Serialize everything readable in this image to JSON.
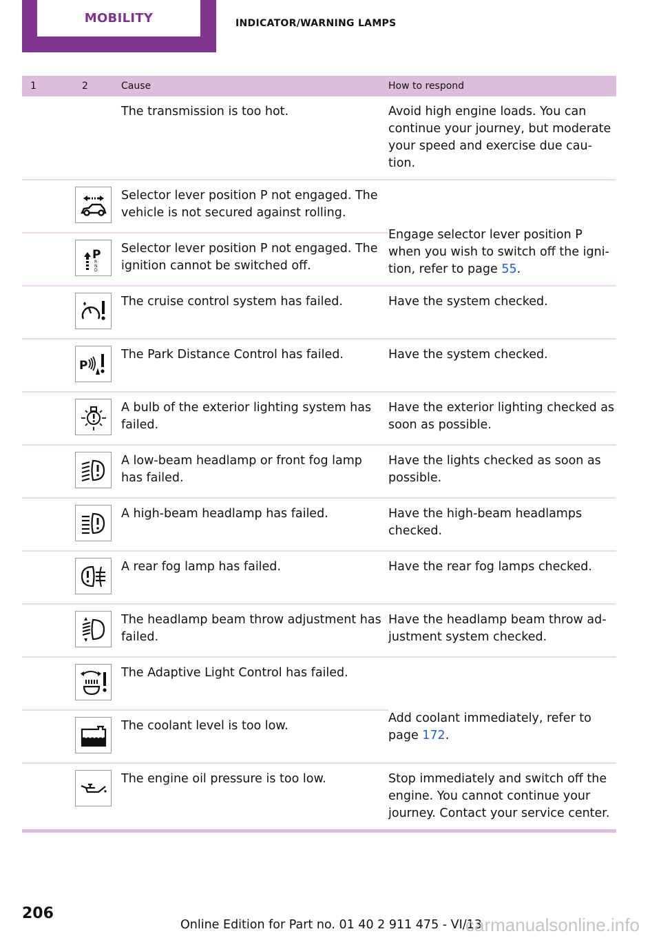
{
  "header": {
    "chapter": "MOBILITY",
    "section": "INDICATOR/WARNING LAMPS"
  },
  "colors": {
    "brand": "#7f348e",
    "header_row": "#dcbddb",
    "link": "#1a5fd6"
  },
  "table": {
    "columns": [
      "1",
      "2",
      "Cause",
      "How to respond"
    ],
    "rows": [
      {
        "icon": "none",
        "cause": "The transmission is too hot.",
        "respond": "Avoid high engine loads. You can continue your journey, but moderate your speed and exercise due cau-tion."
      },
      {
        "icon": "car-rolling-icon",
        "cause": "Selector lever position P not engaged. The vehicle is not secured against rolling.",
        "respond": ""
      },
      {
        "icon": "selector-lever-p-icon",
        "cause": "Selector lever position P not engaged. The ignition cannot be switched off.",
        "respond_prefix": "Engage selector lever position P when you wish to switch off the igni-tion, refer to page ",
        "respond_link": "55",
        "respond_suffix": "."
      },
      {
        "icon": "cruise-control-warning-icon",
        "cause": "The cruise control system has failed.",
        "respond": "Have the system checked."
      },
      {
        "icon": "park-distance-control-warning-icon",
        "cause": "The Park Distance Control has failed.",
        "respond": "Have the system checked."
      },
      {
        "icon": "exterior-bulb-warning-icon",
        "cause": "A bulb of the exterior lighting system has failed.",
        "respond": "Have the exterior lighting checked as soon as possible."
      },
      {
        "icon": "low-beam-warning-icon",
        "cause": "A low-beam headlamp or front fog lamp has failed.",
        "respond": "Have the lights checked as soon as possible."
      },
      {
        "icon": "high-beam-warning-icon",
        "cause": "A high-beam headlamp has failed.",
        "respond": "Have the high-beam headlamps checked."
      },
      {
        "icon": "rear-fog-lamp-warning-icon",
        "cause": "A rear fog lamp has failed.",
        "respond": "Have the rear fog lamps checked."
      },
      {
        "icon": "headlamp-range-adjust-icon",
        "cause": "The headlamp beam throw adjustment has failed.",
        "respond": "Have the headlamp beam throw ad-justment system checked."
      },
      {
        "icon": "adaptive-light-warning-icon",
        "cause": "The Adaptive Light Control has failed.",
        "respond": ""
      },
      {
        "icon": "coolant-level-icon",
        "cause": "The coolant level is too low.",
        "respond_prefix": "Add coolant immediately, refer to page ",
        "respond_link": "172",
        "respond_suffix": "."
      },
      {
        "icon": "oil-pressure-icon",
        "cause": "The engine oil pressure is too low.",
        "respond": "Stop immediately and switch off the engine. You cannot continue your journey. Contact your service center."
      }
    ]
  },
  "footer": {
    "page_number": "206",
    "edition": "Online Edition for Part no. 01 40 2 911 475 - VI/13",
    "watermark": "carmanualsonline.info"
  }
}
